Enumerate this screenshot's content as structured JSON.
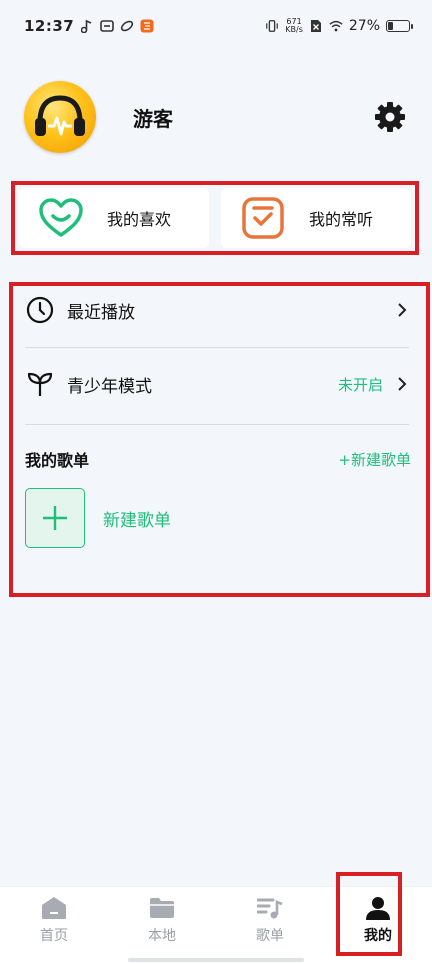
{
  "status_bar": {
    "time": "12:37",
    "net_speed_value": "671",
    "net_speed_unit": "KB/s",
    "battery_percent": "27%"
  },
  "profile": {
    "username": "游客"
  },
  "quick_cards": {
    "favorites_label": "我的喜欢",
    "frequent_label": "我的常听"
  },
  "list": {
    "recent_label": "最近播放",
    "youth_label": "青少年模式",
    "youth_status": "未开启"
  },
  "playlists": {
    "title": "我的歌单",
    "new_link": "+新建歌单",
    "new_button_label": "新建歌单"
  },
  "bottom_nav": {
    "home": "首页",
    "local": "本地",
    "playlist": "歌单",
    "mine": "我的"
  },
  "colors": {
    "accent_green": "#1fbf7a",
    "frequent_orange": "#e8743b",
    "highlight_red": "#d81f26"
  }
}
